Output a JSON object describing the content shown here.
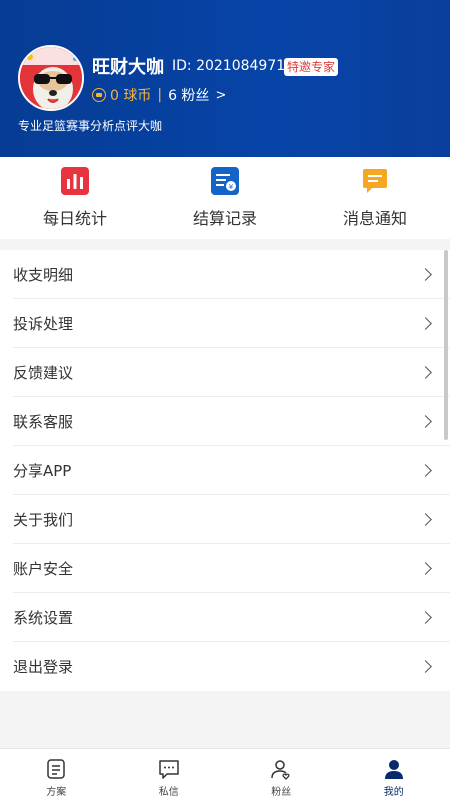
{
  "profile": {
    "name": "旺财大咖",
    "id_text": "ID: 2021084971",
    "badge": "特邀专家",
    "coins": "0 球币",
    "separator": "|",
    "fans": "6 粉丝",
    "fans_arrow": ">",
    "bio": "专业足篮赛事分析点评大咖"
  },
  "quick_actions": [
    {
      "label": "每日统计",
      "icon": "bar-chart-icon",
      "color": "#e8343f"
    },
    {
      "label": "结算记录",
      "icon": "receipt-icon",
      "color": "#1463c8"
    },
    {
      "label": "消息通知",
      "icon": "message-icon",
      "color": "#f5a623"
    }
  ],
  "menu": [
    {
      "label": "收支明细"
    },
    {
      "label": "投诉处理"
    },
    {
      "label": "反馈建议"
    },
    {
      "label": "联系客服"
    },
    {
      "label": "分享APP"
    },
    {
      "label": "关于我们"
    },
    {
      "label": "账户安全"
    },
    {
      "label": "系统设置"
    },
    {
      "label": "退出登录"
    }
  ],
  "tabs": [
    {
      "label": "方案",
      "icon": "document-icon"
    },
    {
      "label": "私信",
      "icon": "chat-icon"
    },
    {
      "label": "粉丝",
      "icon": "fans-icon"
    },
    {
      "label": "我的",
      "icon": "user-icon",
      "active": true
    }
  ],
  "colors": {
    "header": "#0744a8",
    "coin": "#f3b43c",
    "badge_text": "#e03c3c",
    "active_tab": "#0a2b6b"
  }
}
